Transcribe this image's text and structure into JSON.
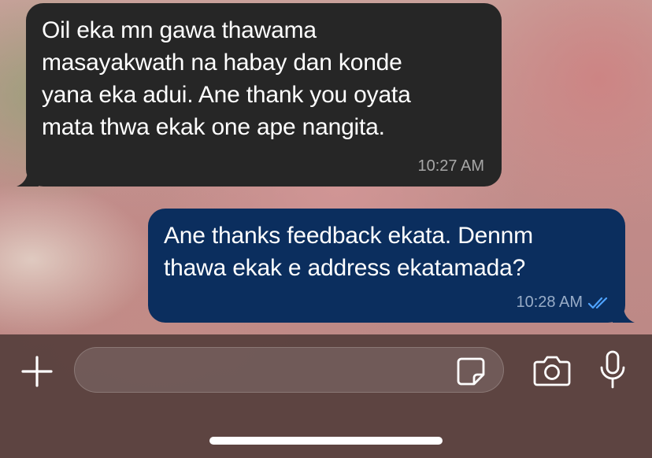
{
  "chat": {
    "messages": [
      {
        "direction": "incoming",
        "text": "Oil eka mn gawa thawama\nmasayakwath na habay dan konde\nyana eka adui. Ane thank you oyata\nmata thwa ekak one ape nangita.",
        "time": "10:27 AM"
      },
      {
        "direction": "outgoing",
        "text": "Ane thanks feedback ekata. Dennm\nthawa ekak e address ekatamada?",
        "time": "10:28 AM",
        "status_icon": "double-check-icon"
      }
    ]
  },
  "input_bar": {
    "placeholder": "",
    "value": "",
    "icons": {
      "attach": "plus-icon",
      "sticker": "sticker-icon",
      "camera": "camera-icon",
      "voice": "microphone-icon"
    }
  },
  "colors": {
    "incoming_bubble": "#262626",
    "outgoing_bubble": "#0b2e5e",
    "read_receipt": "#4fa3ff",
    "input_bar_bg": "#50403a"
  }
}
